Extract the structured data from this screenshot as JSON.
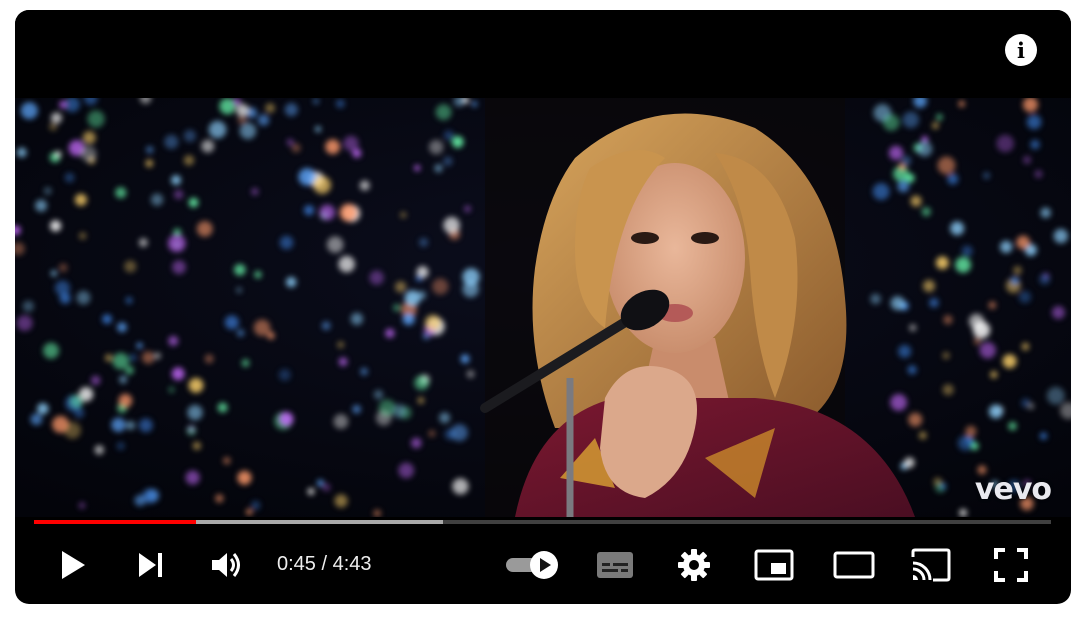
{
  "player": {
    "time": {
      "current": "0:45",
      "separator": " / ",
      "duration": "4:43"
    },
    "progress": {
      "played_fraction": 0.159,
      "buffered_fraction": 0.402
    },
    "watermark": "vevo",
    "colors": {
      "accent": "#ff0000",
      "background": "#000000",
      "icon": "#ffffff"
    },
    "icons": {
      "info": "info-icon",
      "play": "play-icon",
      "next": "next-icon",
      "volume": "volume-icon",
      "autoplay": "autoplay-toggle-icon",
      "subtitles": "subtitles-icon",
      "settings": "settings-gear-icon",
      "miniplayer": "miniplayer-icon",
      "theater": "theater-mode-icon",
      "cast": "cast-icon",
      "fullscreen": "fullscreen-icon"
    }
  }
}
